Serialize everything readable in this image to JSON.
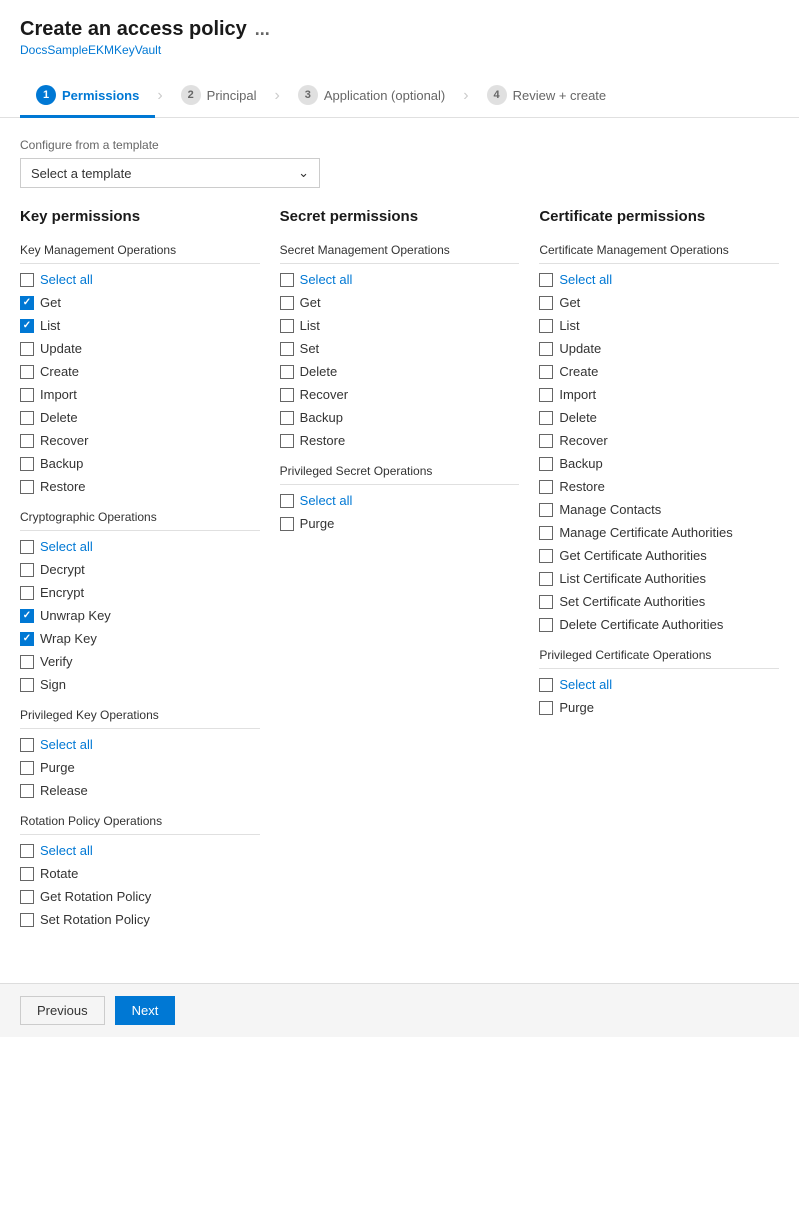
{
  "header": {
    "title": "Create an access policy",
    "subtitle": "DocsSampleEKMKeyVault",
    "dots": "..."
  },
  "tabs": [
    {
      "id": "permissions",
      "step": "1",
      "label": "Permissions",
      "active": true
    },
    {
      "id": "principal",
      "step": "2",
      "label": "Principal",
      "active": false
    },
    {
      "id": "application",
      "step": "3",
      "label": "Application (optional)",
      "active": false
    },
    {
      "id": "review",
      "step": "4",
      "label": "Review + create",
      "active": false
    }
  ],
  "template": {
    "label": "Configure from a template",
    "placeholder": "Select a template"
  },
  "columns": [
    {
      "id": "key",
      "title": "Key permissions",
      "sections": [
        {
          "id": "key-management",
          "title": "Key Management Operations",
          "items": [
            {
              "id": "km-selectall",
              "label": "Select all",
              "checked": false,
              "blue": true
            },
            {
              "id": "km-get",
              "label": "Get",
              "checked": true,
              "blue": false
            },
            {
              "id": "km-list",
              "label": "List",
              "checked": true,
              "blue": false
            },
            {
              "id": "km-update",
              "label": "Update",
              "checked": false,
              "blue": false
            },
            {
              "id": "km-create",
              "label": "Create",
              "checked": false,
              "blue": false
            },
            {
              "id": "km-import",
              "label": "Import",
              "checked": false,
              "blue": false
            },
            {
              "id": "km-delete",
              "label": "Delete",
              "checked": false,
              "blue": false
            },
            {
              "id": "km-recover",
              "label": "Recover",
              "checked": false,
              "blue": false
            },
            {
              "id": "km-backup",
              "label": "Backup",
              "checked": false,
              "blue": false
            },
            {
              "id": "km-restore",
              "label": "Restore",
              "checked": false,
              "blue": false
            }
          ]
        },
        {
          "id": "cryptographic",
          "title": "Cryptographic Operations",
          "items": [
            {
              "id": "cr-selectall",
              "label": "Select all",
              "checked": false,
              "blue": true
            },
            {
              "id": "cr-decrypt",
              "label": "Decrypt",
              "checked": false,
              "blue": false
            },
            {
              "id": "cr-encrypt",
              "label": "Encrypt",
              "checked": false,
              "blue": false
            },
            {
              "id": "cr-unwrapkey",
              "label": "Unwrap Key",
              "checked": true,
              "blue": false
            },
            {
              "id": "cr-wrapkey",
              "label": "Wrap Key",
              "checked": true,
              "blue": false
            },
            {
              "id": "cr-verify",
              "label": "Verify",
              "checked": false,
              "blue": false
            },
            {
              "id": "cr-sign",
              "label": "Sign",
              "checked": false,
              "blue": false
            }
          ]
        },
        {
          "id": "privileged-key",
          "title": "Privileged Key Operations",
          "items": [
            {
              "id": "pk-selectall",
              "label": "Select all",
              "checked": false,
              "blue": true
            },
            {
              "id": "pk-purge",
              "label": "Purge",
              "checked": false,
              "blue": false
            },
            {
              "id": "pk-release",
              "label": "Release",
              "checked": false,
              "blue": false
            }
          ]
        },
        {
          "id": "rotation-policy",
          "title": "Rotation Policy Operations",
          "items": [
            {
              "id": "rp-selectall",
              "label": "Select all",
              "checked": false,
              "blue": true
            },
            {
              "id": "rp-rotate",
              "label": "Rotate",
              "checked": false,
              "blue": false
            },
            {
              "id": "rp-getrotation",
              "label": "Get Rotation Policy",
              "checked": false,
              "blue": false
            },
            {
              "id": "rp-setrotation",
              "label": "Set Rotation Policy",
              "checked": false,
              "blue": false
            }
          ]
        }
      ]
    },
    {
      "id": "secret",
      "title": "Secret permissions",
      "sections": [
        {
          "id": "secret-management",
          "title": "Secret Management Operations",
          "items": [
            {
              "id": "sm-selectall",
              "label": "Select all",
              "checked": false,
              "blue": true
            },
            {
              "id": "sm-get",
              "label": "Get",
              "checked": false,
              "blue": false
            },
            {
              "id": "sm-list",
              "label": "List",
              "checked": false,
              "blue": false
            },
            {
              "id": "sm-set",
              "label": "Set",
              "checked": false,
              "blue": false
            },
            {
              "id": "sm-delete",
              "label": "Delete",
              "checked": false,
              "blue": false
            },
            {
              "id": "sm-recover",
              "label": "Recover",
              "checked": false,
              "blue": false
            },
            {
              "id": "sm-backup",
              "label": "Backup",
              "checked": false,
              "blue": false
            },
            {
              "id": "sm-restore",
              "label": "Restore",
              "checked": false,
              "blue": false
            }
          ]
        },
        {
          "id": "privileged-secret",
          "title": "Privileged Secret Operations",
          "items": [
            {
              "id": "ps-selectall",
              "label": "Select all",
              "checked": false,
              "blue": true
            },
            {
              "id": "ps-purge",
              "label": "Purge",
              "checked": false,
              "blue": false
            }
          ]
        }
      ]
    },
    {
      "id": "certificate",
      "title": "Certificate permissions",
      "sections": [
        {
          "id": "cert-management",
          "title": "Certificate Management Operations",
          "items": [
            {
              "id": "cm-selectall",
              "label": "Select all",
              "checked": false,
              "blue": true
            },
            {
              "id": "cm-get",
              "label": "Get",
              "checked": false,
              "blue": false
            },
            {
              "id": "cm-list",
              "label": "List",
              "checked": false,
              "blue": false
            },
            {
              "id": "cm-update",
              "label": "Update",
              "checked": false,
              "blue": false
            },
            {
              "id": "cm-create",
              "label": "Create",
              "checked": false,
              "blue": false
            },
            {
              "id": "cm-import",
              "label": "Import",
              "checked": false,
              "blue": false
            },
            {
              "id": "cm-delete",
              "label": "Delete",
              "checked": false,
              "blue": false
            },
            {
              "id": "cm-recover",
              "label": "Recover",
              "checked": false,
              "blue": false
            },
            {
              "id": "cm-backup",
              "label": "Backup",
              "checked": false,
              "blue": false
            },
            {
              "id": "cm-restore",
              "label": "Restore",
              "checked": false,
              "blue": false
            },
            {
              "id": "cm-managecontacts",
              "label": "Manage Contacts",
              "checked": false,
              "blue": false
            },
            {
              "id": "cm-manageca",
              "label": "Manage Certificate Authorities",
              "checked": false,
              "blue": false
            },
            {
              "id": "cm-getca",
              "label": "Get Certificate Authorities",
              "checked": false,
              "blue": false
            },
            {
              "id": "cm-listca",
              "label": "List Certificate Authorities",
              "checked": false,
              "blue": false
            },
            {
              "id": "cm-setca",
              "label": "Set Certificate Authorities",
              "checked": false,
              "blue": false
            },
            {
              "id": "cm-deleteca",
              "label": "Delete Certificate Authorities",
              "checked": false,
              "blue": false
            }
          ]
        },
        {
          "id": "privileged-cert",
          "title": "Privileged Certificate Operations",
          "items": [
            {
              "id": "pc-selectall",
              "label": "Select all",
              "checked": false,
              "blue": true
            },
            {
              "id": "pc-purge",
              "label": "Purge",
              "checked": false,
              "blue": false
            }
          ]
        }
      ]
    }
  ],
  "footer": {
    "previous_label": "Previous",
    "next_label": "Next"
  }
}
